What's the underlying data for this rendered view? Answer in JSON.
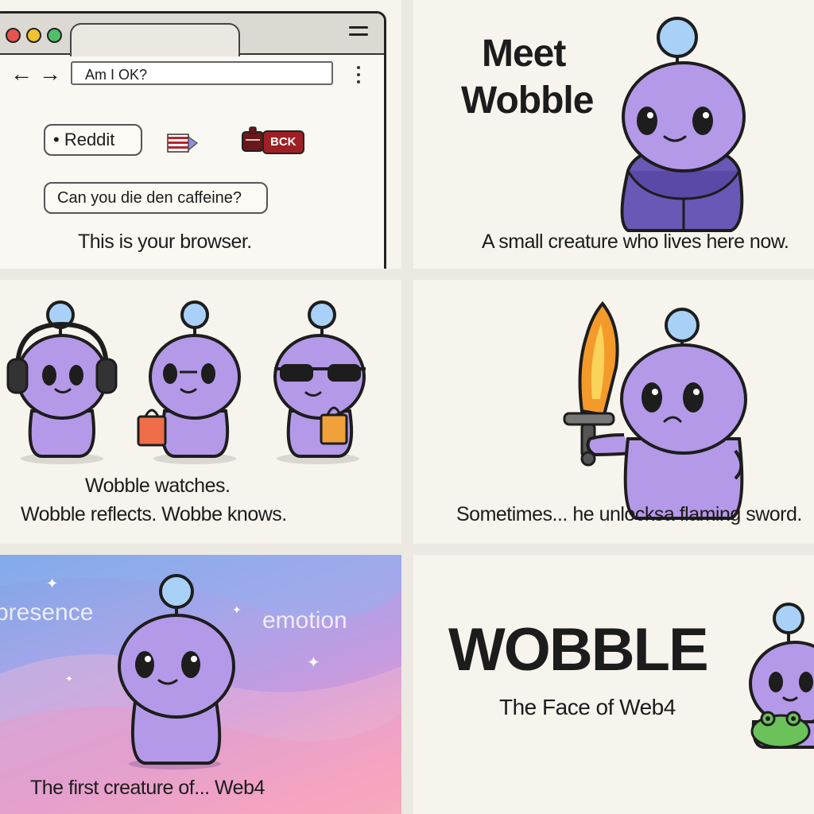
{
  "panel1": {
    "address_value": "Am I OK?",
    "reddit_label": "• Reddit",
    "bck_label": "BCK",
    "suggestion": "Can you die den caffeine?",
    "caption": "This is your browser.",
    "colors": {
      "close": "#e7544f",
      "minimize": "#f0c330",
      "maximize": "#4fbf6a"
    }
  },
  "panel2": {
    "title_line1": "Meet",
    "title_line2": "Wobble",
    "caption": "A small creature who lives here now."
  },
  "panel3": {
    "caption_line1": "Wobble watches.",
    "caption_line2": "Wobble reflects. Wobbe knows."
  },
  "panel4": {
    "caption": "Sometimes... he unlocksa flaming sword."
  },
  "panel5": {
    "word_left": "presence",
    "word_right": "emotion",
    "caption": "The first creature of... Web4"
  },
  "panel6": {
    "title": "WOBBLE",
    "subtitle": "The Face of Web4"
  },
  "character": {
    "body_color": "#b399e8",
    "outline_color": "#1d1d1d",
    "orb_color": "#a9d1f7"
  }
}
